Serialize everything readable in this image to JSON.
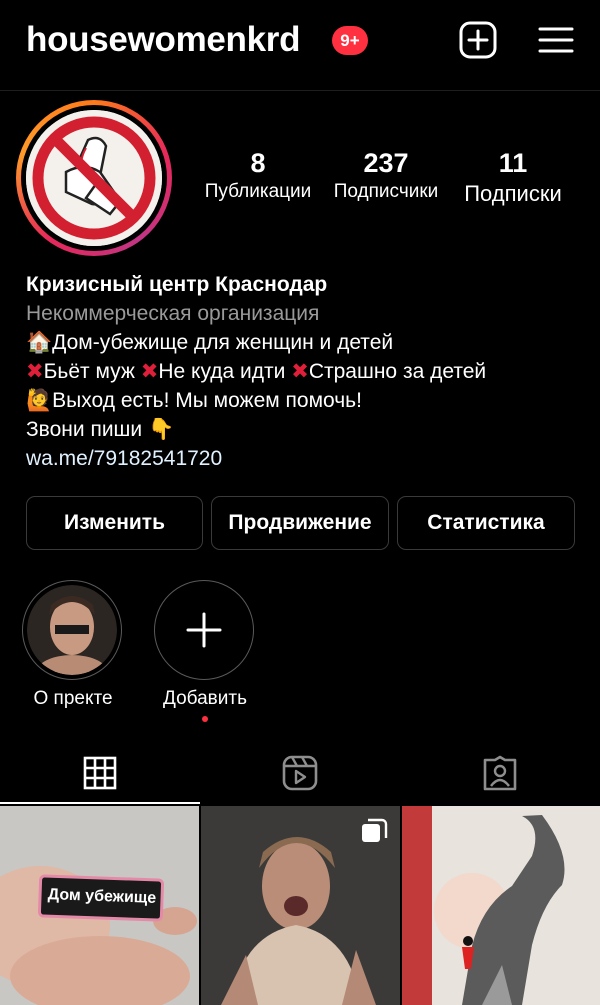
{
  "header": {
    "username": "housewomenkrd",
    "notification_badge": "9+",
    "create_icon": "plus-square-icon",
    "menu_icon": "hamburger-menu-icon"
  },
  "profile": {
    "stats": [
      {
        "value": "8",
        "label": "Публикации"
      },
      {
        "value": "237",
        "label": "Подписчики"
      },
      {
        "value": "11",
        "label": "Подписки"
      }
    ],
    "name": "Кризисный центр Краснодар",
    "category": "Некоммерческая организация",
    "bio": {
      "line1": "Дом-убежище для женщин и детей",
      "line2_a": "Бьёт муж",
      "line2_b": "Не куда идти",
      "line2_c": "Страшно за детей",
      "line3": "Выход есть! Мы можем помочь!",
      "line4": "Звони пиши"
    },
    "link": "wa.me/79182541720"
  },
  "actions": {
    "edit": "Изменить",
    "promote": "Продвижение",
    "insights": "Статистика"
  },
  "highlights": [
    {
      "label": "О пректе"
    },
    {
      "label": "Добавить"
    }
  ],
  "tabs": [
    {
      "icon": "grid-icon",
      "active": true
    },
    {
      "icon": "reels-icon",
      "active": false
    },
    {
      "icon": "tagged-icon",
      "active": false
    }
  ],
  "posts": [
    {
      "caption": "Дом убежище"
    },
    {
      "multi": true
    },
    {}
  ],
  "colors": {
    "badge": "#ff3040",
    "accent_red": "#e0203a",
    "link": "#e0f1ff",
    "category": "#9a9a9a"
  }
}
